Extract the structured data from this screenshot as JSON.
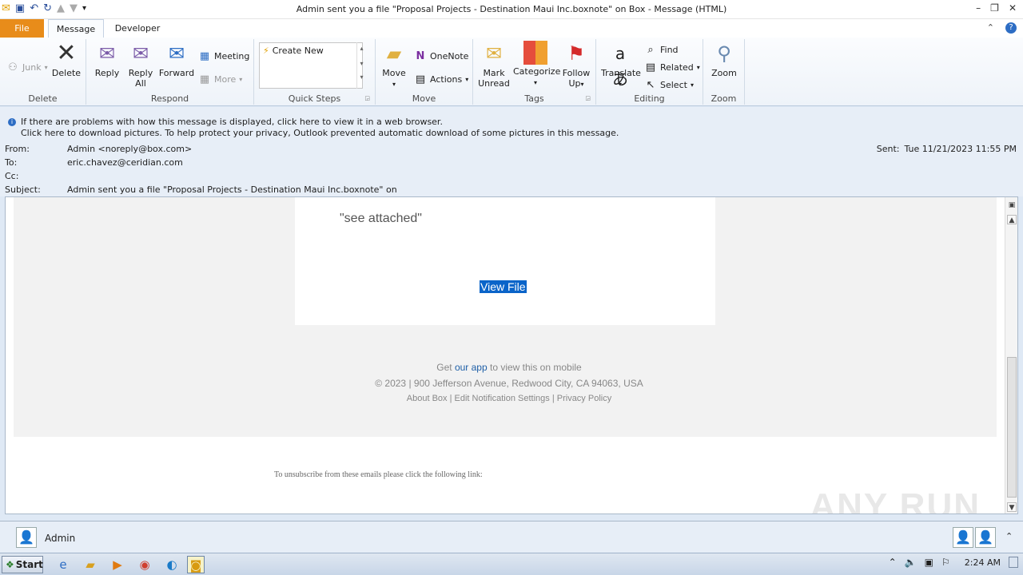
{
  "window": {
    "title": "Admin sent you a file \"Proposal Projects - Destination Maui Inc.boxnote\" on Box   -  Message (HTML)"
  },
  "tabs": [
    "File",
    "Message",
    "Developer"
  ],
  "ribbon": {
    "delete_group": {
      "label": "Delete",
      "junk": "Junk",
      "delete": "Delete"
    },
    "respond_group": {
      "label": "Respond",
      "reply": "Reply",
      "reply_all_1": "Reply",
      "reply_all_2": "All",
      "forward": "Forward",
      "meeting": "Meeting",
      "more": "More"
    },
    "quicksteps_group": {
      "label": "Quick Steps",
      "create_new": "Create New"
    },
    "move_group": {
      "label": "Move",
      "move": "Move",
      "onenote": "OneNote",
      "actions": "Actions"
    },
    "tags_group": {
      "label": "Tags",
      "mark_unread_1": "Mark",
      "mark_unread_2": "Unread",
      "categorize": "Categorize",
      "follow_up_1": "Follow",
      "follow_up_2": "Up"
    },
    "editing_group": {
      "label": "Editing",
      "translate": "Translate",
      "find": "Find",
      "related": "Related",
      "select": "Select"
    },
    "zoom_group": {
      "label": "Zoom",
      "zoom": "Zoom"
    }
  },
  "infobar": {
    "line1": "If there are problems with how this message is displayed, click here to view it in a web browser.",
    "line2": "Click here to download pictures. To help protect your privacy, Outlook prevented automatic download of some pictures in this message."
  },
  "header": {
    "from_label": "From:",
    "from": "Admin <noreply@box.com>",
    "to_label": "To:",
    "to": "eric.chavez@ceridian.com",
    "cc_label": "Cc:",
    "subject_label": "Subject:",
    "subject": "Admin sent you a file \"Proposal Projects - Destination Maui Inc.boxnote\" on",
    "sent_label": "Sent:",
    "sent": "Tue 11/21/2023 11:55 PM"
  },
  "message": {
    "quote": "\"see attached\"",
    "view_file": "View File",
    "get_prefix": "Get ",
    "our_app": "our app",
    "get_suffix": " to view this on mobile",
    "copyright": "© 2023 | 900 Jefferson Avenue, Redwood City, CA 94063, USA",
    "about": "About Box",
    "notif": "Edit Notification Settings",
    "privacy": "Privacy Policy",
    "sep": " | ",
    "unsubscribe": "To unsubscribe from these emails please click the following link:"
  },
  "watermark": "ANY RUN",
  "people_pane": {
    "name": "Admin"
  },
  "taskbar": {
    "start": "Start",
    "clock": "2:24 AM"
  }
}
